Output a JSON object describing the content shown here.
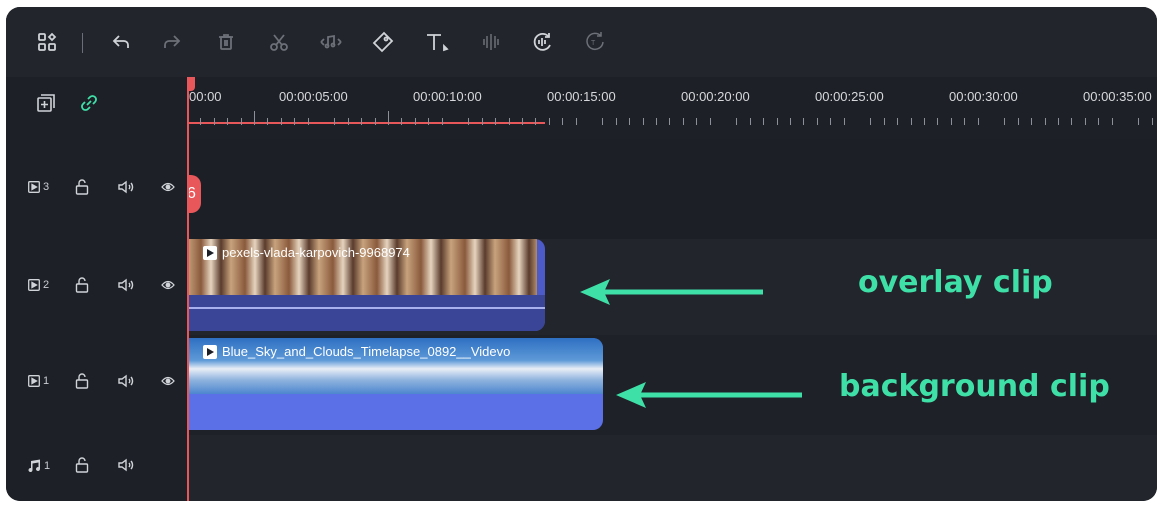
{
  "toolbar": {
    "icons": [
      "layout-grid-icon",
      "undo-icon",
      "redo-icon",
      "delete-icon",
      "cut-icon",
      "audio-icon",
      "tag-icon",
      "text-icon",
      "split-icon",
      "audio-sync-icon",
      "speed-icon"
    ]
  },
  "header_controls": {
    "add_track_icon": "add-track-icon",
    "link_icon": "link-icon"
  },
  "ruler": {
    "labels": [
      "00:00",
      "00:00:05:00",
      "00:00:10:00",
      "00:00:15:00",
      "00:00:20:00",
      "00:00:25:00",
      "00:00:30:00",
      "00:00:35:00"
    ]
  },
  "tracks": [
    {
      "type": "video",
      "number": "3"
    },
    {
      "type": "video",
      "number": "2"
    },
    {
      "type": "video",
      "number": "1"
    },
    {
      "type": "audio",
      "number": "1"
    }
  ],
  "clips": {
    "overlay": {
      "name": "pexels-vlada-karpovich-9968974",
      "color": "#5b66d6"
    },
    "background": {
      "name": "Blue_Sky_and_Clouds_Timelapse_0892__Videvo",
      "color": "#5b6fe6"
    }
  },
  "marker_glyph": "6",
  "annotations": {
    "overlay": "overlay clip",
    "background": "background clip",
    "color": "#3ee0a8"
  }
}
